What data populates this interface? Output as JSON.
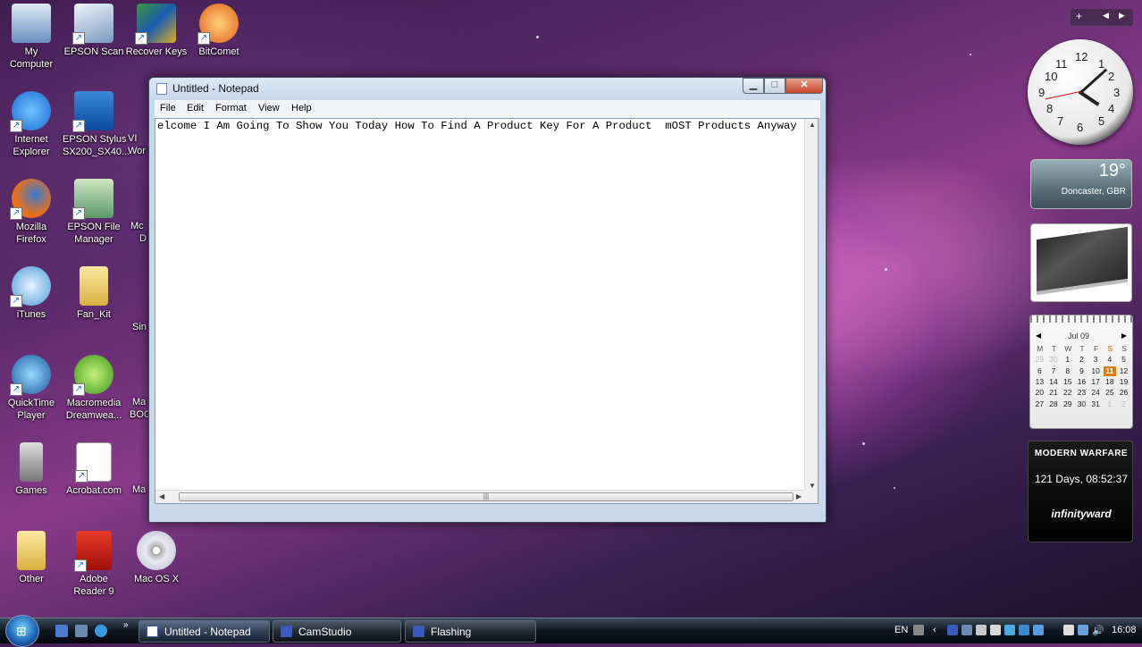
{
  "desktop": {
    "icons": [
      {
        "label": "My\nComputer",
        "icon": "computer-icon"
      },
      {
        "label": "EPSON Scan",
        "icon": "scanner-icon"
      },
      {
        "label": "Recover Keys",
        "icon": "recover-keys-icon"
      },
      {
        "label": "BitComet",
        "icon": "bitcomet-icon"
      },
      {
        "label": "Internet\nExplorer",
        "icon": "internet-explorer-icon"
      },
      {
        "label": "EPSON Stylus\nSX200_SX40...",
        "icon": "printer-icon"
      },
      {
        "label": "Mozilla\nFirefox",
        "icon": "firefox-icon"
      },
      {
        "label": "EPSON File\nManager",
        "icon": "file-manager-icon"
      },
      {
        "label": "iTunes",
        "icon": "itunes-icon"
      },
      {
        "label": "Fan_Kit",
        "icon": "folder-icon"
      },
      {
        "label": "QuickTime\nPlayer",
        "icon": "quicktime-icon"
      },
      {
        "label": "Macromedia\nDreamwea...",
        "icon": "dreamweaver-icon"
      },
      {
        "label": "Games",
        "icon": "games-icon"
      },
      {
        "label": "Acrobat.com",
        "icon": "acrobat-icon"
      },
      {
        "label": "Other",
        "icon": "folder-icon"
      },
      {
        "label": "Adobe\nReader 9",
        "icon": "adobe-reader-icon"
      },
      {
        "label": "Mac OS X",
        "icon": "cd-icon"
      }
    ],
    "partial_labels": [
      "VI",
      "Wor",
      "Mc",
      "D",
      "Sin",
      "Ma",
      "BOC",
      "Ma"
    ]
  },
  "notepad": {
    "title": "Untitled - Notepad",
    "menu": [
      "File",
      "Edit",
      "Format",
      "View",
      "Help"
    ],
    "content": "elcome I Am Going To Show You Today How To Find A Product Key For A Product  mOST Products Anyway"
  },
  "gadgets": {
    "clock": {
      "numbers": [
        "12",
        "1",
        "2",
        "3",
        "4",
        "5",
        "6",
        "7",
        "8",
        "9",
        "10",
        "11"
      ],
      "hour": 4,
      "minute": 8,
      "second": 43
    },
    "weather": {
      "temperature": "19°",
      "location": "Doncaster, GBR"
    },
    "calendar": {
      "month": "Jul 09",
      "weekdays": [
        "M",
        "T",
        "W",
        "T",
        "F",
        "S",
        "S"
      ],
      "weeks": [
        [
          "29",
          "30",
          "1",
          "2",
          "3",
          "4",
          "5"
        ],
        [
          "6",
          "7",
          "8",
          "9",
          "10",
          "11",
          "12"
        ],
        [
          "13",
          "14",
          "15",
          "16",
          "17",
          "18",
          "19"
        ],
        [
          "20",
          "21",
          "22",
          "23",
          "24",
          "25",
          "26"
        ],
        [
          "27",
          "28",
          "29",
          "30",
          "31",
          "1",
          "2"
        ]
      ],
      "today": "11"
    },
    "countdown": {
      "game": "MODERN WARFARE",
      "remaining": "121 Days, 08:52:37",
      "studio": "infinityward"
    }
  },
  "taskbar": {
    "buttons": [
      {
        "label": "Untitled - Notepad",
        "active": true
      },
      {
        "label": "CamStudio",
        "active": false
      },
      {
        "label": "Flashing",
        "active": false
      }
    ],
    "language": "EN",
    "time": "16:08"
  },
  "colors": {
    "window_close": "#c8442a",
    "calendar_today": "#e07a10",
    "taskbar": "#0e1620"
  }
}
